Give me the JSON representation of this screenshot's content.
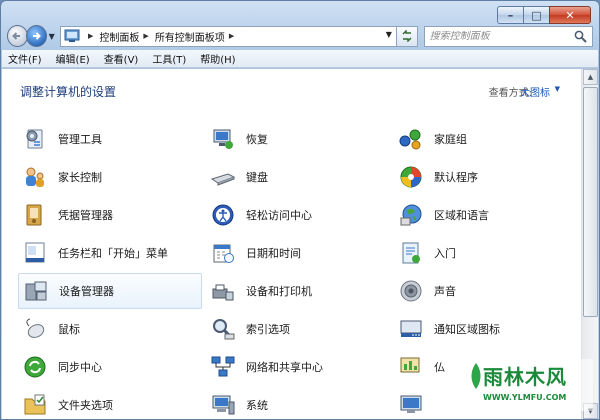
{
  "window": {
    "caption": {
      "minimize": "–",
      "maximize": "□",
      "close": "✕"
    }
  },
  "nav": {
    "breadcrumb": [
      "控制面板",
      "所有控制面板项"
    ],
    "search_placeholder": "搜索控制面板"
  },
  "menubar": [
    {
      "label": "文件(F)"
    },
    {
      "label": "编辑(E)"
    },
    {
      "label": "查看(V)"
    },
    {
      "label": "工具(T)"
    },
    {
      "label": "帮助(H)"
    }
  ],
  "main": {
    "title": "调整计算机的设置",
    "view_by_label": "查看方式:",
    "view_mode": "大图标"
  },
  "items": [
    {
      "label": "管理工具",
      "icon": "admin-tools-icon"
    },
    {
      "label": "恢复",
      "icon": "recovery-icon"
    },
    {
      "label": "家庭组",
      "icon": "homegroup-icon"
    },
    {
      "label": "家长控制",
      "icon": "parental-controls-icon"
    },
    {
      "label": "键盘",
      "icon": "keyboard-icon"
    },
    {
      "label": "默认程序",
      "icon": "default-programs-icon"
    },
    {
      "label": "凭据管理器",
      "icon": "credential-manager-icon"
    },
    {
      "label": "轻松访问中心",
      "icon": "ease-of-access-icon"
    },
    {
      "label": "区域和语言",
      "icon": "region-language-icon"
    },
    {
      "label": "任务栏和「开始」菜单",
      "icon": "taskbar-icon"
    },
    {
      "label": "日期和时间",
      "icon": "date-time-icon"
    },
    {
      "label": "入门",
      "icon": "getting-started-icon"
    },
    {
      "label": "设备管理器",
      "icon": "device-manager-icon",
      "selected": true
    },
    {
      "label": "设备和打印机",
      "icon": "devices-printers-icon"
    },
    {
      "label": "声音",
      "icon": "sound-icon"
    },
    {
      "label": "鼠标",
      "icon": "mouse-icon"
    },
    {
      "label": "索引选项",
      "icon": "indexing-icon"
    },
    {
      "label": "通知区域图标",
      "icon": "notification-area-icon"
    },
    {
      "label": "同步中心",
      "icon": "sync-center-icon"
    },
    {
      "label": "网络和共享中心",
      "icon": "network-sharing-icon"
    },
    {
      "label": "仏",
      "icon": "performance-icon"
    },
    {
      "label": "文件夹选项",
      "icon": "folder-options-icon"
    },
    {
      "label": "系统",
      "icon": "system-icon"
    },
    {
      "label": "",
      "icon": "display-icon"
    }
  ],
  "watermark": {
    "title": "雨林木风",
    "url": "WWW.YLMFU.COM"
  },
  "colors": {
    "title": "#1e3d7a",
    "link": "#1f54b8",
    "watermark": "#1b8a3a"
  }
}
